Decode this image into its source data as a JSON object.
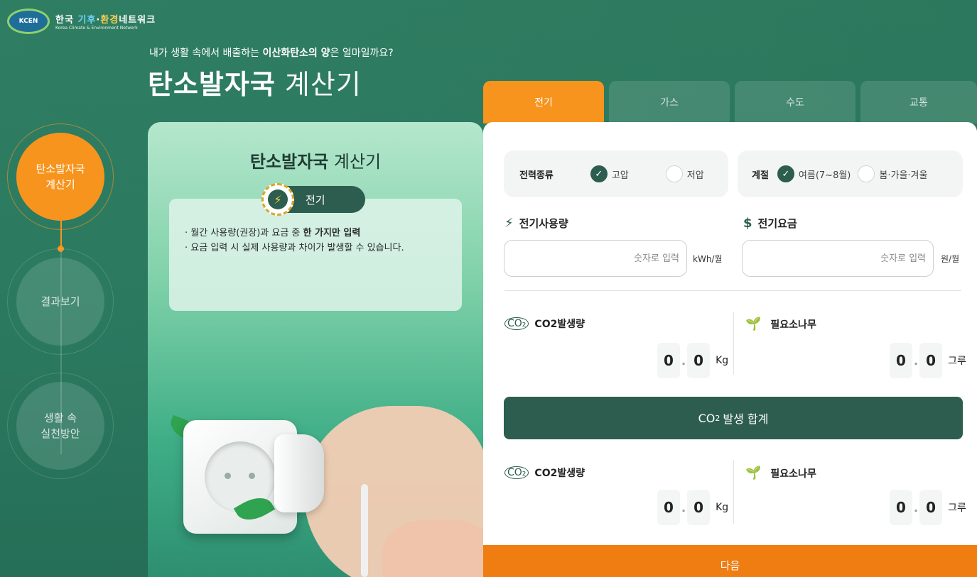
{
  "header": {
    "logo_badge": "KCEN",
    "logo_korean_part1": "한국",
    "logo_korean_part2": "기후",
    "logo_korean_part3": "환경",
    "logo_korean_part4": "네트워크",
    "logo_english": "Korea Climate & Environment Network",
    "subtitle_pre": "내가 생활 속에서 배출하는 ",
    "subtitle_bold": "이산화탄소의 양",
    "subtitle_post": "은 얼마일까요?",
    "title_bold": "탄소발자국",
    "title_light": "계산기"
  },
  "steps": [
    {
      "line1": "탄소발자국",
      "line2": "계산기"
    },
    {
      "line1": "결과보기",
      "line2": ""
    },
    {
      "line1": "생활 속",
      "line2": "실천방안"
    }
  ],
  "left_card": {
    "title_bold": "탄소발자국",
    "title_light": "계산기",
    "pill_label": "전기",
    "line1_pre": "· 월간 사용량(권장)과 요금 중 ",
    "line1_bold": "한 가지만 입력",
    "line2": "· 요금 입력 시 실제 사용량과 차이가 발생할 수 있습니다."
  },
  "tabs": [
    "전기",
    "가스",
    "수도",
    "교통"
  ],
  "options": {
    "power_label": "전력종류",
    "power_high": "고압",
    "power_low": "저압",
    "season_label": "계절",
    "season_summer": "여름(7~8월)",
    "season_other": "봄·가을·겨울"
  },
  "inputs": {
    "usage_label": "전기사용량",
    "usage_placeholder": "숫자로 입력",
    "usage_unit": "kWh/월",
    "fee_label": "전기요금",
    "fee_placeholder": "숫자로 입력",
    "fee_unit": "원/월"
  },
  "stats": {
    "co2_label": "CO2발생량",
    "co2_icon_text": "CO₂",
    "co2_int": "0",
    "co2_dec": "0",
    "co2_unit": "Kg",
    "tree_label": "필요소나무",
    "tree_int": "0",
    "tree_dec": "0",
    "tree_unit": "그루"
  },
  "total": {
    "co": "CO",
    "sub": "2",
    "rest": "발생 합계"
  },
  "totals_stats": {
    "co2_label": "CO2발생량",
    "co2_icon_text": "CO₂",
    "co2_int": "0",
    "co2_dec": "0",
    "co2_unit": "Kg",
    "tree_label": "필요소나무",
    "tree_int": "0",
    "tree_dec": "0",
    "tree_unit": "그루"
  },
  "next_label": "다음",
  "colors": {
    "bg": "#2b7a60",
    "accent": "#f7941d",
    "dark_green": "#2d5d4f",
    "next": "#ef7d12"
  }
}
